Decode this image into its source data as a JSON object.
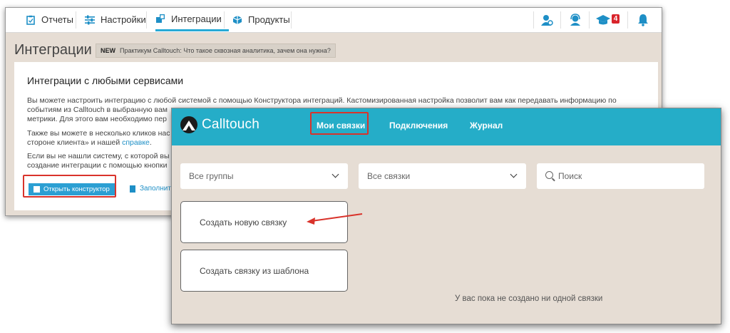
{
  "back": {
    "nav": {
      "tabs": [
        {
          "label": "Отчеты",
          "icon": "clipboard-icon"
        },
        {
          "label": "Настройки",
          "icon": "sliders-icon"
        },
        {
          "label": "Интеграции",
          "icon": "puzzle-icon"
        },
        {
          "label": "Продукты",
          "icon": "products-icon"
        }
      ],
      "active_tab": "Интеграции",
      "right_icons": [
        "user-settings-icon",
        "support-icon",
        "graduation-cap-icon",
        "bell-icon"
      ],
      "badge_count": "4"
    },
    "page_title": "Интеграции",
    "new_badge": "NEW",
    "new_text": "Практикум Calltouch: Что такое сквозная аналитика, зачем она нужна?",
    "panel": {
      "heading": "Интеграции с любыми сервисами",
      "p1_line1": "Вы можете настроить интеграцию с любой системой с помощью Конструктора интеграций. Кастомизированная настройка позволит вам как передавать информацию по",
      "p1_line2": "событиям из Calltouch в выбранную вам",
      "p1_line3": "метрики. Для этого вам необходимо пер",
      "p2_line1": "Также вы можете в несколько кликов нас",
      "p2_line2_text": "стороне клиента» и нашей",
      "p2_link": "справке",
      "p3_line1": "Если вы не нашли систему, с которой вы",
      "p3_line2": "создание интеграции с помощью кнопки",
      "open_button": "Открыть конструктор",
      "fill_link": "Заполнить"
    }
  },
  "front": {
    "brand": "Calltouch",
    "tabs": [
      "Мои связки",
      "Подключения",
      "Журнал"
    ],
    "active_tab": "Мои связки",
    "filters": {
      "groups": "Все группы",
      "links": "Все связки",
      "search_placeholder": "Поиск"
    },
    "cards": [
      "Создать новую связку",
      "Создать связку из шаблона"
    ],
    "empty_message": "У вас пока не создано ни одной связки"
  },
  "colors": {
    "accent": "#25adc8",
    "link": "#1e8fc6",
    "highlight": "#d9332b",
    "background": "#e6ddd4"
  }
}
